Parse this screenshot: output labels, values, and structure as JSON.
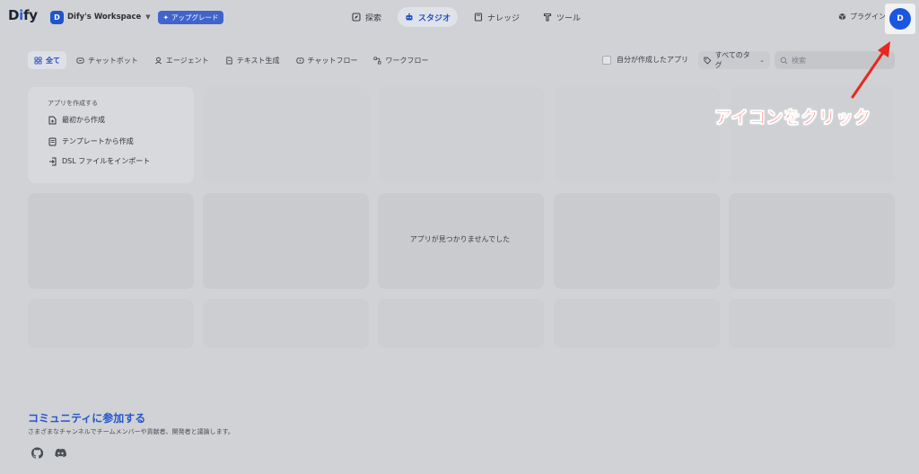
{
  "header": {
    "logo": {
      "left": "D",
      "accent": "i",
      "right": "fy"
    },
    "workspace": {
      "badge": "D",
      "name": "Dify's Workspace"
    },
    "upgrade_label": "アップグレード",
    "nav": [
      {
        "label": "探索",
        "icon": "explore-icon"
      },
      {
        "label": "スタジオ",
        "icon": "robot-icon",
        "active": true
      },
      {
        "label": "ナレッジ",
        "icon": "book-icon"
      },
      {
        "label": "ツール",
        "icon": "tool-icon"
      }
    ],
    "plugin_label": "プラグイン",
    "avatar_initial": "D"
  },
  "filters": {
    "tabs": [
      {
        "label": "全て",
        "icon": "grid-icon",
        "active": true
      },
      {
        "label": "チャットボット",
        "icon": "chat-icon"
      },
      {
        "label": "エージェント",
        "icon": "agent-icon"
      },
      {
        "label": "テキスト生成",
        "icon": "document-icon"
      },
      {
        "label": "チャットフロー",
        "icon": "chatflow-icon"
      },
      {
        "label": "ワークフロー",
        "icon": "workflow-icon"
      }
    ],
    "mine_label": "自分が作成したアプリ",
    "tags_label": "すべてのタグ",
    "search_placeholder": "検索"
  },
  "create_card": {
    "title": "アプリを作成する",
    "items": [
      {
        "label": "最初から作成",
        "icon": "new-file-icon"
      },
      {
        "label": "テンプレートから作成",
        "icon": "template-icon"
      },
      {
        "label": "DSL ファイルをインポート",
        "icon": "import-icon"
      }
    ]
  },
  "empty_message": "アプリが見つかりませんでした",
  "community": {
    "title": "コミュニティに参加する",
    "description": "さまざまなチャンネルでチームメンバーや貢献者、開発者と議論します。"
  },
  "annotation": {
    "text": "アイコンをクリック",
    "color": "#e8281f"
  },
  "colors": {
    "accent": "#2350c5",
    "avatar": "#1957e0",
    "overlay_background": "#d1d2d5"
  }
}
